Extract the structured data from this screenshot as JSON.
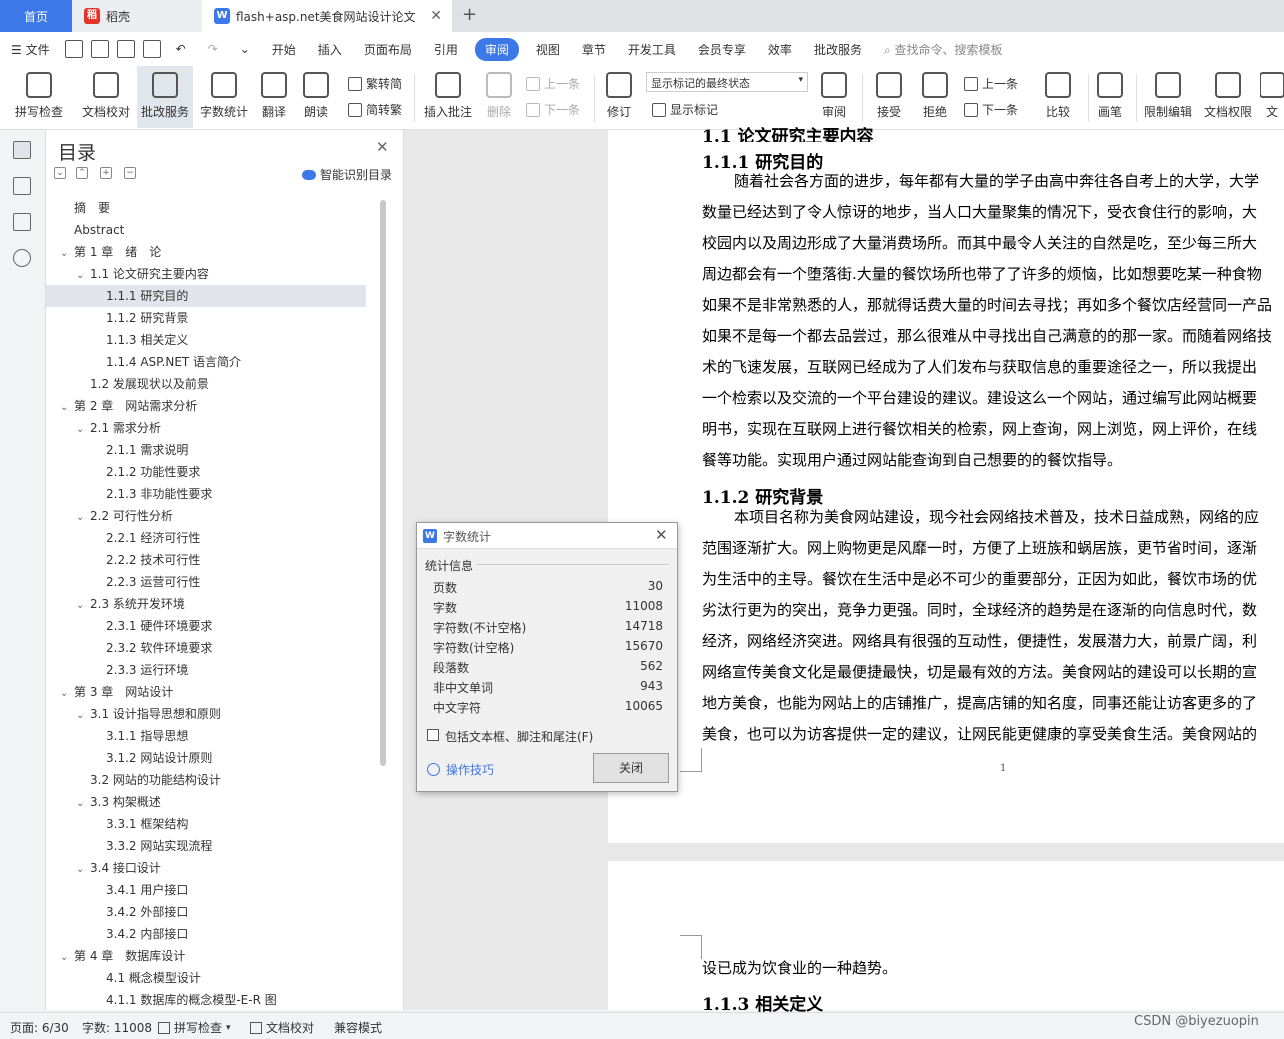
{
  "tabs": {
    "home": "首页",
    "daoke": "稻壳",
    "doc": "flash+asp.net美食网站设计论文"
  },
  "menu": {
    "file": "文件",
    "items": [
      "开始",
      "插入",
      "页面布局",
      "引用",
      "审阅",
      "视图",
      "章节",
      "开发工具",
      "会员专享",
      "效率",
      "批改服务"
    ],
    "active": "审阅",
    "search": "查找命令、搜索模板"
  },
  "ribbon": {
    "spell": "拼写检查",
    "proofread": "文档校对",
    "correct": "批改服务",
    "wordcount": "字数统计",
    "translate": "翻译",
    "read": "朗读",
    "trad": "繁转简",
    "simp": "简转繁",
    "insert_comment": "插入批注",
    "delete": "删除",
    "prev": "上一条",
    "next": "下一条",
    "revise": "修订",
    "mark_state": "显示标记的最终状态",
    "show_marks": "显示标记",
    "review": "审阅",
    "accept": "接受",
    "reject": "拒绝",
    "prev2": "上一条",
    "next2": "下一条",
    "compare": "比较",
    "pen": "画笔",
    "restrict": "限制编辑",
    "permission": "文档权限",
    "doc_cut": "文"
  },
  "toc": {
    "title": "目录",
    "smart": "智能识别目录",
    "items": [
      {
        "label": "摘　要",
        "level": 0,
        "arrow": ""
      },
      {
        "label": "Abstract",
        "level": 0,
        "arrow": ""
      },
      {
        "label": "第 1 章　绪　论",
        "level": 0,
        "arrow": "v"
      },
      {
        "label": "1.1  论文研究主要内容",
        "level": 1,
        "arrow": "v"
      },
      {
        "label": "1.1.1  研究目的",
        "level": 2,
        "arrow": "",
        "selected": true
      },
      {
        "label": "1.1.2 研究背景",
        "level": 2,
        "arrow": ""
      },
      {
        "label": "1.1.3 相关定义",
        "level": 2,
        "arrow": ""
      },
      {
        "label": "1.1.4 ASP.NET 语言简介",
        "level": 2,
        "arrow": ""
      },
      {
        "label": "1.2  发展现状以及前景",
        "level": 1,
        "arrow": ""
      },
      {
        "label": "第 2 章　网站需求分析",
        "level": 0,
        "arrow": "v"
      },
      {
        "label": "2.1  需求分析",
        "level": 1,
        "arrow": "v"
      },
      {
        "label": "2.1.1  需求说明",
        "level": 2,
        "arrow": ""
      },
      {
        "label": "2.1.2  功能性要求",
        "level": 2,
        "arrow": ""
      },
      {
        "label": "2.1.3  非功能性要求",
        "level": 2,
        "arrow": ""
      },
      {
        "label": "2.2 可行性分析",
        "level": 1,
        "arrow": "v"
      },
      {
        "label": "2.2.1  经济可行性",
        "level": 2,
        "arrow": ""
      },
      {
        "label": "2.2.2  技术可行性",
        "level": 2,
        "arrow": ""
      },
      {
        "label": "2.2.3  运营可行性",
        "level": 2,
        "arrow": ""
      },
      {
        "label": "2.3  系统开发环境",
        "level": 1,
        "arrow": "v"
      },
      {
        "label": "2.3.1 硬件环境要求",
        "level": 2,
        "arrow": ""
      },
      {
        "label": "2.3.2 软件环境要求",
        "level": 2,
        "arrow": ""
      },
      {
        "label": "2.3.3 运行环境",
        "level": 2,
        "arrow": ""
      },
      {
        "label": "第 3 章　网站设计",
        "level": 0,
        "arrow": "v"
      },
      {
        "label": "3.1  设计指导思想和原则",
        "level": 1,
        "arrow": "v"
      },
      {
        "label": "3.1.1  指导思想",
        "level": 2,
        "arrow": ""
      },
      {
        "label": "3.1.2  网站设计原则",
        "level": 2,
        "arrow": ""
      },
      {
        "label": "3.2  网站的功能结构设计",
        "level": 1,
        "arrow": ""
      },
      {
        "label": "3.3  构架概述",
        "level": 1,
        "arrow": "v"
      },
      {
        "label": "3.3.1  框架结构",
        "level": 2,
        "arrow": ""
      },
      {
        "label": "3.3.2  网站实现流程",
        "level": 2,
        "arrow": ""
      },
      {
        "label": "3.4  接口设计",
        "level": 1,
        "arrow": "v"
      },
      {
        "label": "3.4.1  用户接口",
        "level": 2,
        "arrow": ""
      },
      {
        "label": "3.4.2  外部接口",
        "level": 2,
        "arrow": ""
      },
      {
        "label": "3.4.2  内部接口",
        "level": 2,
        "arrow": ""
      },
      {
        "label": "第 4 章　数据库设计",
        "level": 0,
        "arrow": "v"
      },
      {
        "label": "4.1  概念模型设计",
        "level": 2,
        "arrow": ""
      },
      {
        "label": "4.1.1  数据库的概念模型-E-R 图",
        "level": 2,
        "arrow": ""
      }
    ]
  },
  "doc": {
    "h_top": "1.1  论文研究主要内容",
    "h111": "1.1.1  研究目的",
    "p1": [
      "随着社会各方面的进步，每年都有大量的学子由高中奔往各自考上的大学，大学",
      "数量已经达到了令人惊讶的地步，当人口大量聚集的情况下，受衣食住行的影响，大",
      "校园内以及周边形成了大量消费场所。而其中最令人关注的自然是吃，至少每三所大",
      "周边都会有一个堕落街.大量的餐饮场所也带了了许多的烦恼，比如想要吃某一种食物",
      "如果不是非常熟悉的人，那就得话费大量的时间去寻找；再如多个餐饮店经营同一产品",
      "如果不是每一个都去品尝过，那么很难从中寻找出自己满意的的那一家。而随着网络技",
      "术的飞速发展，互联网已经成为了人们发布与获取信息的重要途径之一，所以我提出",
      "一个检索以及交流的一个平台建设的建议。建设这么一个网站，通过编写此网站概要",
      "明书，实现在互联网上进行餐饮相关的检索，网上查询，网上浏览，网上评价，在线",
      "餐等功能。实现用户通过网站能查询到自己想要的的餐饮指导。"
    ],
    "h112": "1.1.2 研究背景",
    "p2": [
      "本项目名称为美食网站建设，现今社会网络技术普及，技术日益成熟，网络的应",
      "范围逐渐扩大。网上购物更是风靡一时，方便了上班族和蜗居族，更节省时间，逐渐",
      "为生活中的主导。餐饮在生活中是必不可少的重要部分，正因为如此，餐饮市场的优",
      "劣汰行更为的突出，竞争力更强。同时，全球经济的趋势是在逐渐的向信息时代，数",
      "经济，网络经济突进。网络具有很强的互动性，便捷性，发展潜力大，前景广阔，利",
      "网络宣传美食文化是最便捷最快，切是最有效的方法。美食网站的建设可以长期的宣",
      "地方美食，也能为网站上的店铺推广，提高店铺的知名度，同事还能让访客更多的了",
      "美食，也可以为访客提供一定的建议，让网民能更健康的享受美食生活。美食网站的"
    ],
    "page_num": "1",
    "p3": "设已成为饮食业的一种趋势。",
    "h113": "1.1.3 相关定义"
  },
  "dialog": {
    "title": "字数统计",
    "section": "统计信息",
    "rows": [
      {
        "label": "页数",
        "value": "30"
      },
      {
        "label": "字数",
        "value": "11008"
      },
      {
        "label": "字符数(不计空格)",
        "value": "14718"
      },
      {
        "label": "字符数(计空格)",
        "value": "15670"
      },
      {
        "label": "段落数",
        "value": "562"
      },
      {
        "label": "非中文单词",
        "value": "943"
      },
      {
        "label": "中文字符",
        "value": "10065"
      }
    ],
    "checkbox": "包括文本框、脚注和尾注(F)",
    "tips": "操作技巧",
    "close": "关闭"
  },
  "status": {
    "page": "页面: 6/30",
    "words": "字数: 11008",
    "spell": "拼写检查",
    "proof": "文档校对",
    "compat": "兼容模式"
  },
  "watermark": "CSDN @biyezuopin",
  "colors": {
    "accent": "#3c78e8",
    "daoke": "#e6332a"
  }
}
